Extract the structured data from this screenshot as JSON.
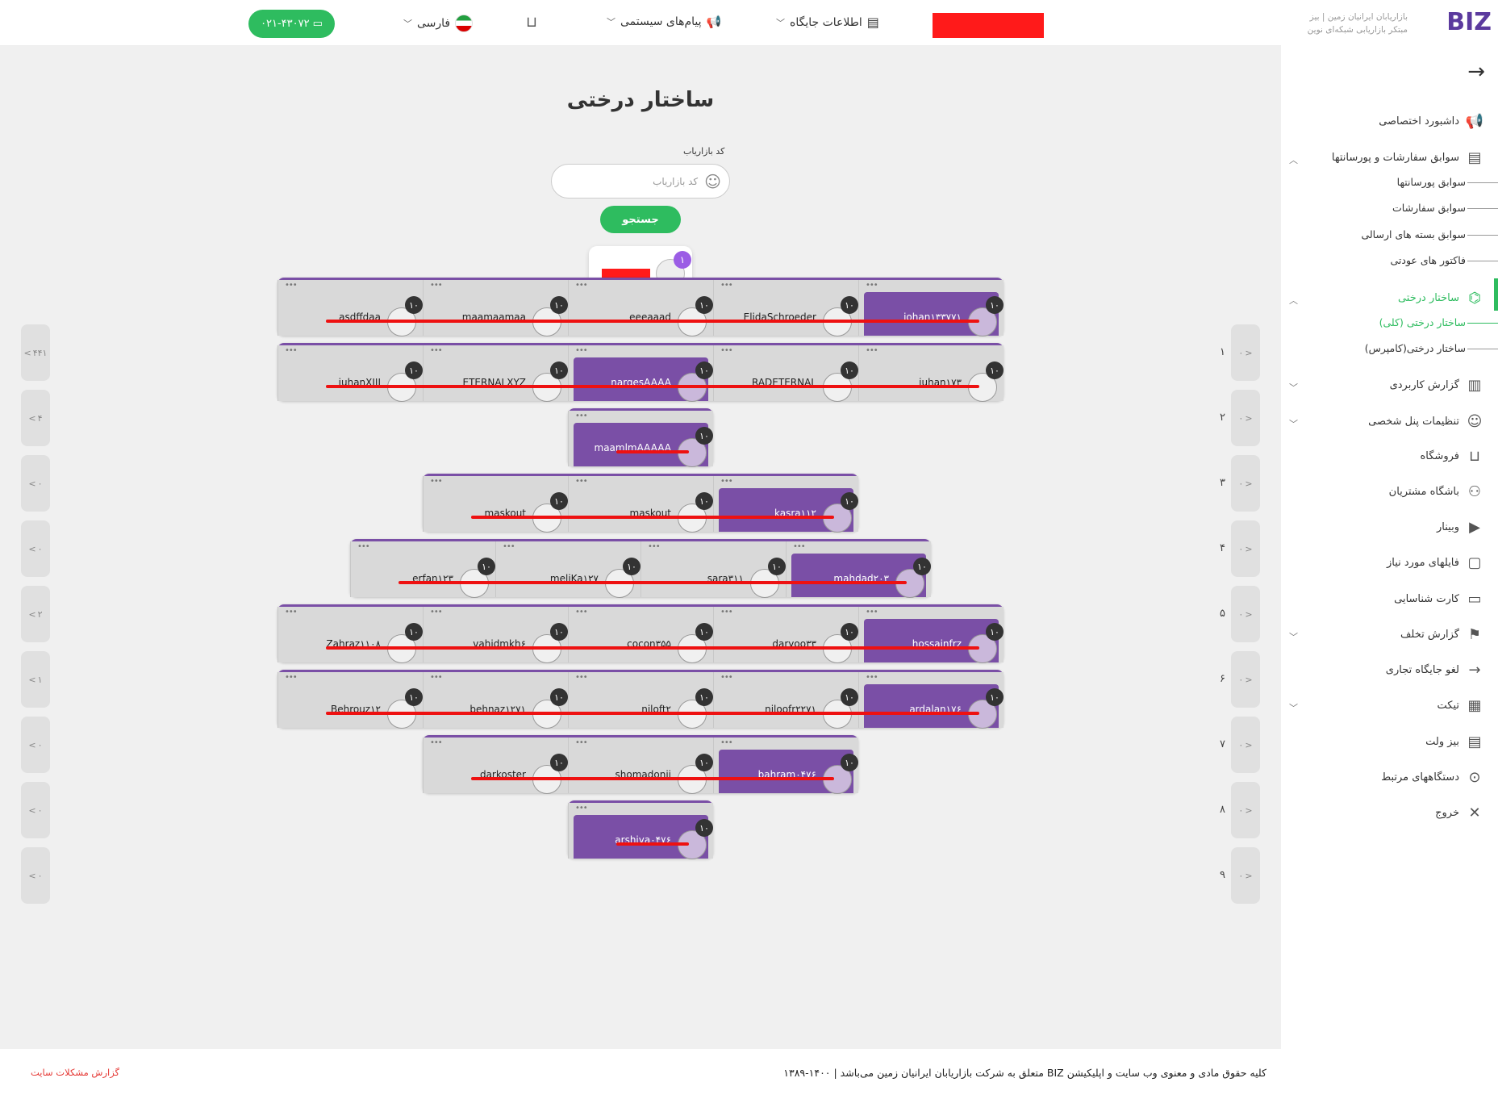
{
  "topbar": {
    "brand_tagline1": "بازاریابان ایرانیان زمین | بیز",
    "brand_tagline2": "مبتکر بازاریابی شبکه‌ای نوین",
    "brand_logo": "BIZ",
    "site_info": "اطلاعات جایگاه",
    "system_messages": "پیام‌های سیستمی",
    "language": "فارسی",
    "phone": "۰۲۱-۴۳۰۷۲"
  },
  "page": {
    "title": "ساختار درختی",
    "search_label": "کد بازاریاب",
    "search_placeholder": "کد بازاریاب",
    "search_button": "جستجو",
    "root_badge": "۱"
  },
  "levels": [
    {
      "num": "۱",
      "right": "۰",
      "left": "۴۴۱"
    },
    {
      "num": "۲",
      "right": "۰",
      "left": "۴"
    },
    {
      "num": "۳",
      "right": "۰",
      "left": "۰"
    },
    {
      "num": "۴",
      "right": "۰",
      "left": "۰"
    },
    {
      "num": "۵",
      "right": "۰",
      "left": "۲"
    },
    {
      "num": "۶",
      "right": "۰",
      "left": "۱"
    },
    {
      "num": "۷",
      "right": "۰",
      "left": "۰"
    },
    {
      "num": "۸",
      "right": "۰",
      "left": "۰"
    },
    {
      "num": "۹",
      "right": "۰",
      "left": "۰"
    }
  ],
  "rows": [
    {
      "cells": [
        {
          "name": "johan۱۳۳۷۷۱",
          "purple": true,
          "badge": "۱۰"
        },
        {
          "name": "ElidaSchroeder",
          "purple": false,
          "badge": "۱۰"
        },
        {
          "name": "eeeaaad",
          "purple": false,
          "badge": "۱۰"
        },
        {
          "name": "maamaamaa",
          "purple": false,
          "badge": "۱۰"
        },
        {
          "name": "asdffdaa",
          "purple": false,
          "badge": "۱۰"
        }
      ]
    },
    {
      "cells": [
        {
          "name": "juhan۱۷۳",
          "purple": false,
          "badge": "۱۰"
        },
        {
          "name": "RADETERNAL",
          "purple": false,
          "badge": "۱۰"
        },
        {
          "name": "nargesAAAA",
          "purple": true,
          "badge": "۱۰"
        },
        {
          "name": "ETERNALXYZ",
          "purple": false,
          "badge": "۱۰"
        },
        {
          "name": "juhanXIII",
          "purple": false,
          "badge": "۱۰"
        }
      ]
    },
    {
      "cells": [
        {
          "name": "maamlmAAAAA",
          "purple": true,
          "badge": "۱۰"
        }
      ]
    },
    {
      "cells": [
        {
          "name": "kasra۱۱۲",
          "purple": true,
          "badge": "۱۰"
        },
        {
          "name": "maskout",
          "purple": false,
          "badge": "۱۰"
        },
        {
          "name": "maskout",
          "purple": false,
          "badge": "۱۰"
        }
      ]
    },
    {
      "cells": [
        {
          "name": "mahdad۲۰۳",
          "purple": true,
          "badge": "۱۰"
        },
        {
          "name": "sara۳۱۱",
          "purple": false,
          "badge": "۱۰"
        },
        {
          "name": "meliKa۱۲۷",
          "purple": false,
          "badge": "۱۰"
        },
        {
          "name": "erfan۱۲۳",
          "purple": false,
          "badge": "۱۰"
        }
      ]
    },
    {
      "cells": [
        {
          "name": "hossainfrz",
          "purple": true,
          "badge": "۱۰"
        },
        {
          "name": "daryoo۳۳",
          "purple": false,
          "badge": "۱۰"
        },
        {
          "name": "cocon۳۵۵",
          "purple": false,
          "badge": "۱۰"
        },
        {
          "name": "vahidmkh۶",
          "purple": false,
          "badge": "۱۰"
        },
        {
          "name": "Zahraz۱۱۰۸",
          "purple": false,
          "badge": "۱۰"
        }
      ]
    },
    {
      "cells": [
        {
          "name": "ardalan۱۷۶",
          "purple": true,
          "badge": "۱۰"
        },
        {
          "name": "niloofr۲۲۷۱",
          "purple": false,
          "badge": "۱۰"
        },
        {
          "name": "niloft۲",
          "purple": false,
          "badge": "۱۰"
        },
        {
          "name": "behnaz۱۲۷۱",
          "purple": false,
          "badge": "۱۰"
        },
        {
          "name": "Behrouz۱۲",
          "purple": false,
          "badge": "۱۰"
        }
      ]
    },
    {
      "cells": [
        {
          "name": "bahram۰۴۷۶",
          "purple": true,
          "badge": "۱۰"
        },
        {
          "name": "shomadonii",
          "purple": false,
          "badge": "۱۰"
        },
        {
          "name": "darkoster",
          "purple": false,
          "badge": "۱۰"
        }
      ]
    },
    {
      "cells": [
        {
          "name": "arshiya۰۴۷۶",
          "purple": true,
          "badge": "۱۰"
        }
      ]
    }
  ],
  "sidebar": {
    "items": [
      {
        "label": "داشبورد اختصاصی",
        "icon": "megaphone-icon",
        "glyph": "📢"
      },
      {
        "label": "سوابق سفارشات و پورسانتها",
        "icon": "document-icon",
        "glyph": "▤",
        "chev": "︿"
      },
      {
        "label": "ساختار درختی",
        "icon": "tree-icon",
        "glyph": "⌬",
        "chev": "︿",
        "active": true
      },
      {
        "label": "گزارش کاربردی",
        "icon": "chart-icon",
        "glyph": "▥",
        "chev": "﹀"
      },
      {
        "label": "تنظیمات پنل شخصی",
        "icon": "user-icon",
        "glyph": "☺",
        "chev": "﹀"
      },
      {
        "label": "فروشگاه",
        "icon": "cart-icon",
        "glyph": "⊔"
      },
      {
        "label": "باشگاه مشتریان",
        "icon": "people-icon",
        "glyph": "⚇"
      },
      {
        "label": "وبینار",
        "icon": "video-icon",
        "glyph": "▶"
      },
      {
        "label": "فایلهای مورد نیاز",
        "icon": "folder-icon",
        "glyph": "▢"
      },
      {
        "label": "کارت شناسایی",
        "icon": "id-card-icon",
        "glyph": "▭"
      },
      {
        "label": "گزارش تخلف",
        "icon": "report-icon",
        "glyph": "⚑",
        "chev": "﹀"
      },
      {
        "label": "لغو جایگاه تجاری",
        "icon": "arrow-right-icon",
        "glyph": "→"
      },
      {
        "label": "تیکت",
        "icon": "barcode-icon",
        "glyph": "▦",
        "chev": "﹀"
      },
      {
        "label": "بیز ولت",
        "icon": "wallet-icon",
        "glyph": "▤"
      },
      {
        "label": "دستگاههای مرتبط",
        "icon": "device-icon",
        "glyph": "⊙"
      },
      {
        "label": "خروج",
        "icon": "close-icon",
        "glyph": "✕"
      }
    ],
    "sub_orders": [
      "سوابق پورسانتها",
      "سوابق سفارشات",
      "سوابق بسته های ارسالی",
      "فاکتور های عودتی"
    ],
    "sub_tree": [
      "ساختار درختی (کلی)",
      "ساختار درختی(کامپرس)"
    ]
  },
  "footer": {
    "copyright": "کلیه حقوق مادی و معنوی وب سایت و اپلیکیشن BIZ متعلق به شرکت بازاریابان ایرانیان زمین می‌باشد | ۱۴۰۰-۱۳۸۹",
    "report": "گزارش مشکلات سایت"
  },
  "colors": {
    "accent": "#2ebc5f",
    "purple": "#7a4fa6",
    "redaction": "#ff1a1a"
  }
}
